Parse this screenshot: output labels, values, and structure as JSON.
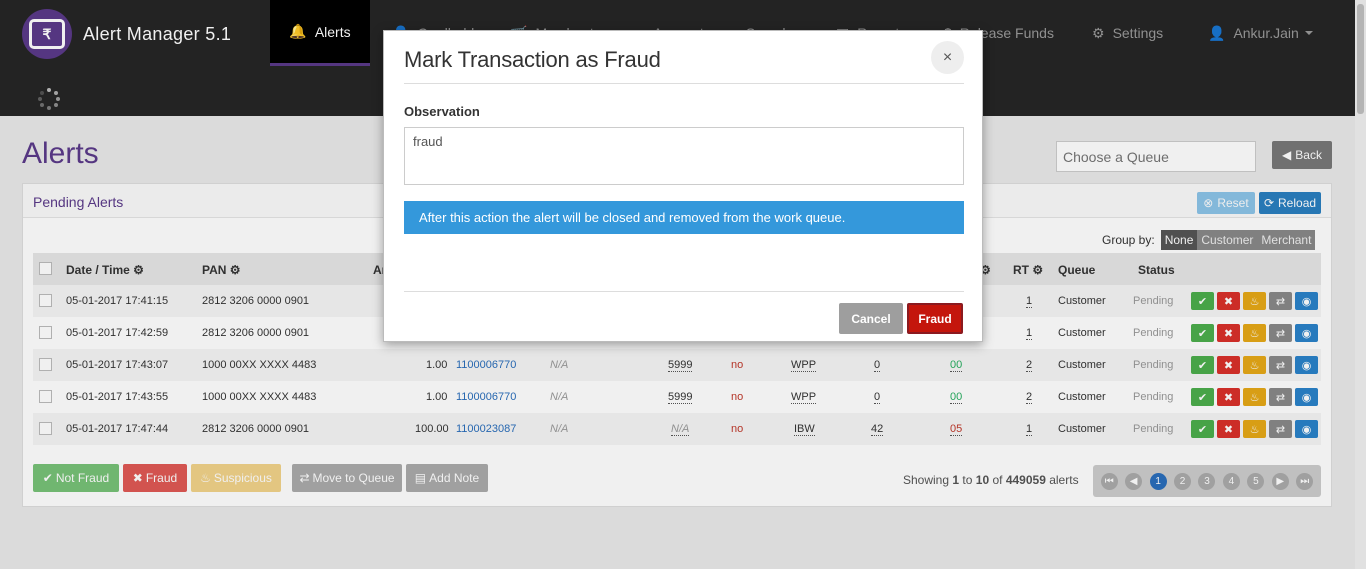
{
  "app": {
    "title": "Alert Manager 5.1",
    "logo_glyph": "₹"
  },
  "nav": {
    "items": [
      {
        "label": "Alerts",
        "icon": "bell-icon",
        "active": true
      },
      {
        "label": "Cardholders",
        "icon": "person-icon"
      },
      {
        "label": "Merchants",
        "icon": "cart-icon"
      },
      {
        "label": "Accounts",
        "icon": "card-icon"
      },
      {
        "label": "Search",
        "icon": "search-icon"
      },
      {
        "label": "Reports",
        "icon": "report-icon"
      },
      {
        "label": "Release Funds",
        "icon": "money-icon"
      },
      {
        "label": "Settings",
        "icon": "gear-icon"
      },
      {
        "label": "Ankur.Jain",
        "icon": "user-icon"
      }
    ]
  },
  "page": {
    "title": "Alerts",
    "queue_placeholder": "Choose a Queue",
    "back_label": "Back"
  },
  "panel": {
    "title": "Pending Alerts",
    "reset_label": "Reset",
    "reload_label": "Reload",
    "group_by_label": "Group by:",
    "group_by_options": [
      "None",
      "Customer",
      "Merchant"
    ],
    "group_by_selected": "None"
  },
  "table": {
    "headers": {
      "datetime": "Date / Time",
      "pan": "PAN",
      "amount": "Ar",
      "rt": "RT",
      "queue": "Queue",
      "status": "Status"
    },
    "rows": [
      {
        "datetime": "05-01-2017 17:41:15",
        "pan": "2812 3206 0000 0901",
        "rt": "1",
        "queue": "Customer",
        "status": "Pending"
      },
      {
        "datetime": "05-01-2017 17:42:59",
        "pan": "2812 3206 0000 0901",
        "rt": "1",
        "queue": "Customer",
        "status": "Pending"
      },
      {
        "datetime": "05-01-2017 17:43:07",
        "pan": "1000 00XX XXXX 4483",
        "amount": "1.00",
        "account": "1100006770",
        "na": "N/A",
        "mcc": "5999",
        "flag": "no",
        "channel": "WPP",
        "c1": "0",
        "c2": "00",
        "rt": "2",
        "queue": "Customer",
        "status": "Pending"
      },
      {
        "datetime": "05-01-2017 17:43:55",
        "pan": "1000 00XX XXXX 4483",
        "amount": "1.00",
        "account": "1100006770",
        "na": "N/A",
        "mcc": "5999",
        "flag": "no",
        "channel": "WPP",
        "c1": "0",
        "c2": "00",
        "rt": "2",
        "queue": "Customer",
        "status": "Pending"
      },
      {
        "datetime": "05-01-2017 17:47:44",
        "pan": "2812 3206 0000 0901",
        "amount": "100.00",
        "account": "1100023087",
        "na": "N/A",
        "mcc": "N/A",
        "flag": "no",
        "channel": "IBW",
        "c1": "42",
        "c2": "05",
        "rt": "1",
        "queue": "Customer",
        "status": "Pending"
      }
    ]
  },
  "bulk_actions": {
    "not_fraud": "Not Fraud",
    "fraud": "Fraud",
    "suspicious": "Suspicious",
    "move_to_queue": "Move to Queue",
    "add_note": "Add Note"
  },
  "pagination": {
    "prefix": "Showing",
    "from": "1",
    "to_word": "to",
    "to": "10",
    "of_word": "of",
    "total": "449059",
    "suffix": "alerts",
    "pages": [
      "1",
      "2",
      "3",
      "4",
      "5"
    ],
    "current": 1
  },
  "modal": {
    "title": "Mark Transaction as Fraud",
    "close_glyph": "×",
    "observation_label": "Observation",
    "observation_value": "fraud",
    "info_text": "After this action the alert will be closed and removed from the work queue.",
    "cancel_label": "Cancel",
    "confirm_label": "Fraud"
  },
  "colors": {
    "brand": "#5b3a8a",
    "info": "#3498db",
    "danger": "#c4160c",
    "success": "#4cae4c",
    "warning": "#e6a817"
  }
}
